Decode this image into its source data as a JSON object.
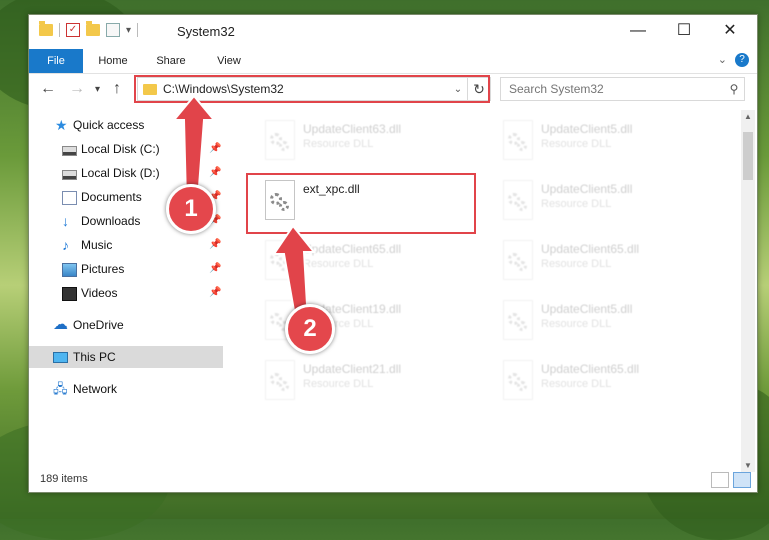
{
  "window": {
    "title": "System32",
    "min": "—",
    "max": "☐",
    "close": "✕"
  },
  "ribbon": {
    "tabs": [
      "File",
      "Home",
      "Share",
      "View"
    ]
  },
  "address": {
    "path": "C:\\Windows\\System32",
    "search_placeholder": "Search System32"
  },
  "sidebar": {
    "items": [
      {
        "label": "Quick access",
        "icon": "star-icon"
      },
      {
        "label": "Local Disk (C:)",
        "icon": "drive-icon",
        "pinned": true
      },
      {
        "label": "Local Disk (D:)",
        "icon": "drive-icon",
        "pinned": true
      },
      {
        "label": "Documents",
        "icon": "documents-icon",
        "pinned": true
      },
      {
        "label": "Downloads",
        "icon": "downloads-icon",
        "pinned": true
      },
      {
        "label": "Music",
        "icon": "music-icon",
        "pinned": true
      },
      {
        "label": "Pictures",
        "icon": "pictures-icon",
        "pinned": true
      },
      {
        "label": "Videos",
        "icon": "videos-icon",
        "pinned": true
      },
      {
        "label": "OneDrive",
        "icon": "onedrive-icon"
      },
      {
        "label": "This PC",
        "icon": "pc-icon",
        "selected": true
      },
      {
        "label": "Network",
        "icon": "network-icon"
      }
    ]
  },
  "files": [
    {
      "name": "UpdateClient63.dll",
      "type": "Resource DLL",
      "faded": true
    },
    {
      "name": "UpdateClient5.dll",
      "type": "Resource DLL",
      "faded": true
    },
    {
      "name": "ext_xpc.dll",
      "type": "",
      "faded": false
    },
    {
      "name": "UpdateClient5.dll",
      "type": "Resource DLL",
      "faded": true
    },
    {
      "name": "UpdateClient65.dll",
      "type": "Resource DLL",
      "faded": true
    },
    {
      "name": "UpdateClient65.dll",
      "type": "Resource DLL",
      "faded": true
    },
    {
      "name": "UpdateClient19.dll",
      "type": "Resource DLL",
      "faded": true
    },
    {
      "name": "UpdateClient5.dll",
      "type": "Resource DLL",
      "faded": true
    },
    {
      "name": "UpdateClient21.dll",
      "type": "Resource DLL",
      "faded": true
    },
    {
      "name": "UpdateClient65.dll",
      "type": "Resource DLL",
      "faded": true
    }
  ],
  "status": {
    "item_count": "189 items"
  },
  "callouts": [
    "1",
    "2"
  ],
  "colors": {
    "highlight": "#e1444a",
    "accent": "#1979ca"
  }
}
